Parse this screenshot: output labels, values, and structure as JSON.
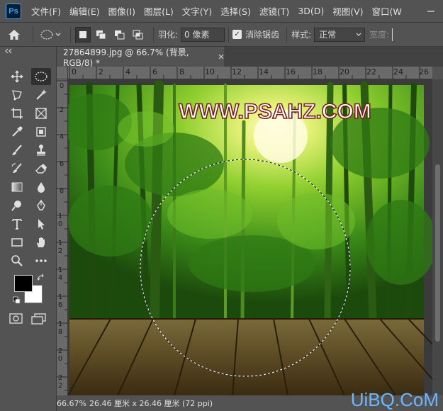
{
  "menu": {
    "items": [
      "文件(F)",
      "编辑(E)",
      "图像(I)",
      "图层(L)",
      "文字(Y)",
      "选择(S)",
      "滤镜(T)",
      "3D(D)",
      "视图(V)",
      "窗口(W"
    ],
    "logo": "Ps"
  },
  "options": {
    "feather_label": "羽化:",
    "feather_value": "0 像素",
    "antialias_label": "消除锯齿",
    "antialias_checked": true,
    "style_label": "样式:",
    "style_value": "正常",
    "width_label": "宽度:"
  },
  "document": {
    "tab_title": "27864899.jpg @ 66.7% (背景, RGB/8) *",
    "watermark_text": "WWW.PSAHZ.COM"
  },
  "rulers": {
    "top": [
      "0",
      "2",
      "4",
      "6",
      "8",
      "10",
      "12",
      "14",
      "16",
      "18",
      "20",
      "22",
      "24",
      "26"
    ],
    "left": [
      "0",
      "2",
      "4",
      "6",
      "8",
      "10",
      "12",
      "14",
      "16",
      "18",
      "20",
      "22"
    ]
  },
  "status": {
    "zoom": "66.67%",
    "doc_info": "26.46 厘米 x 26.46 厘米 (72 ppi)"
  },
  "site_watermark": "UiBQ.CoM",
  "colors": {
    "foreground": "#000000",
    "background": "#ffffff",
    "accent": "#31a8ff"
  }
}
